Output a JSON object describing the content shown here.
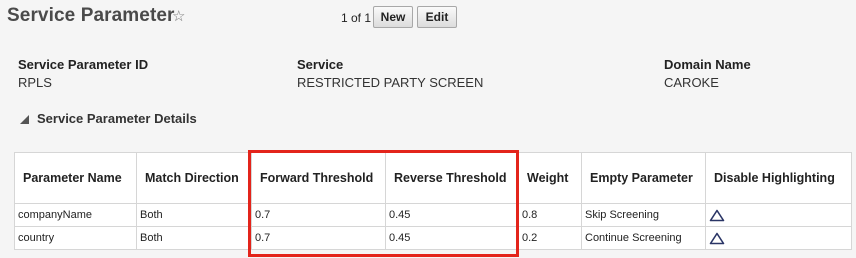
{
  "header": {
    "title": "Service Parameter",
    "pager": "1 of 1",
    "new_label": "New",
    "edit_label": "Edit"
  },
  "fields": [
    {
      "label": "Service Parameter ID",
      "value": "RPLS"
    },
    {
      "label": "Service",
      "value": "RESTRICTED PARTY SCREEN"
    },
    {
      "label": "Domain Name",
      "value": "CAROKE"
    }
  ],
  "section": {
    "title": "Service Parameter Details"
  },
  "table": {
    "columns": [
      "Parameter Name",
      "Match Direction",
      "Forward Threshold",
      "Reverse Threshold",
      "Weight",
      "Empty Parameter",
      "Disable Highlighting"
    ],
    "rows": [
      {
        "name": "companyName",
        "match": "Both",
        "forward": "0.7",
        "reverse": "0.45",
        "weight": "0.8",
        "empty": "Skip Screening",
        "highlight_icon": "triangle-icon"
      },
      {
        "name": "country",
        "match": "Both",
        "forward": "0.7",
        "reverse": "0.45",
        "weight": "0.2",
        "empty": "Continue Screening",
        "highlight_icon": "triangle-icon"
      }
    ]
  },
  "colors": {
    "highlight_box": "#e3241b",
    "icon": "#2a3566"
  }
}
